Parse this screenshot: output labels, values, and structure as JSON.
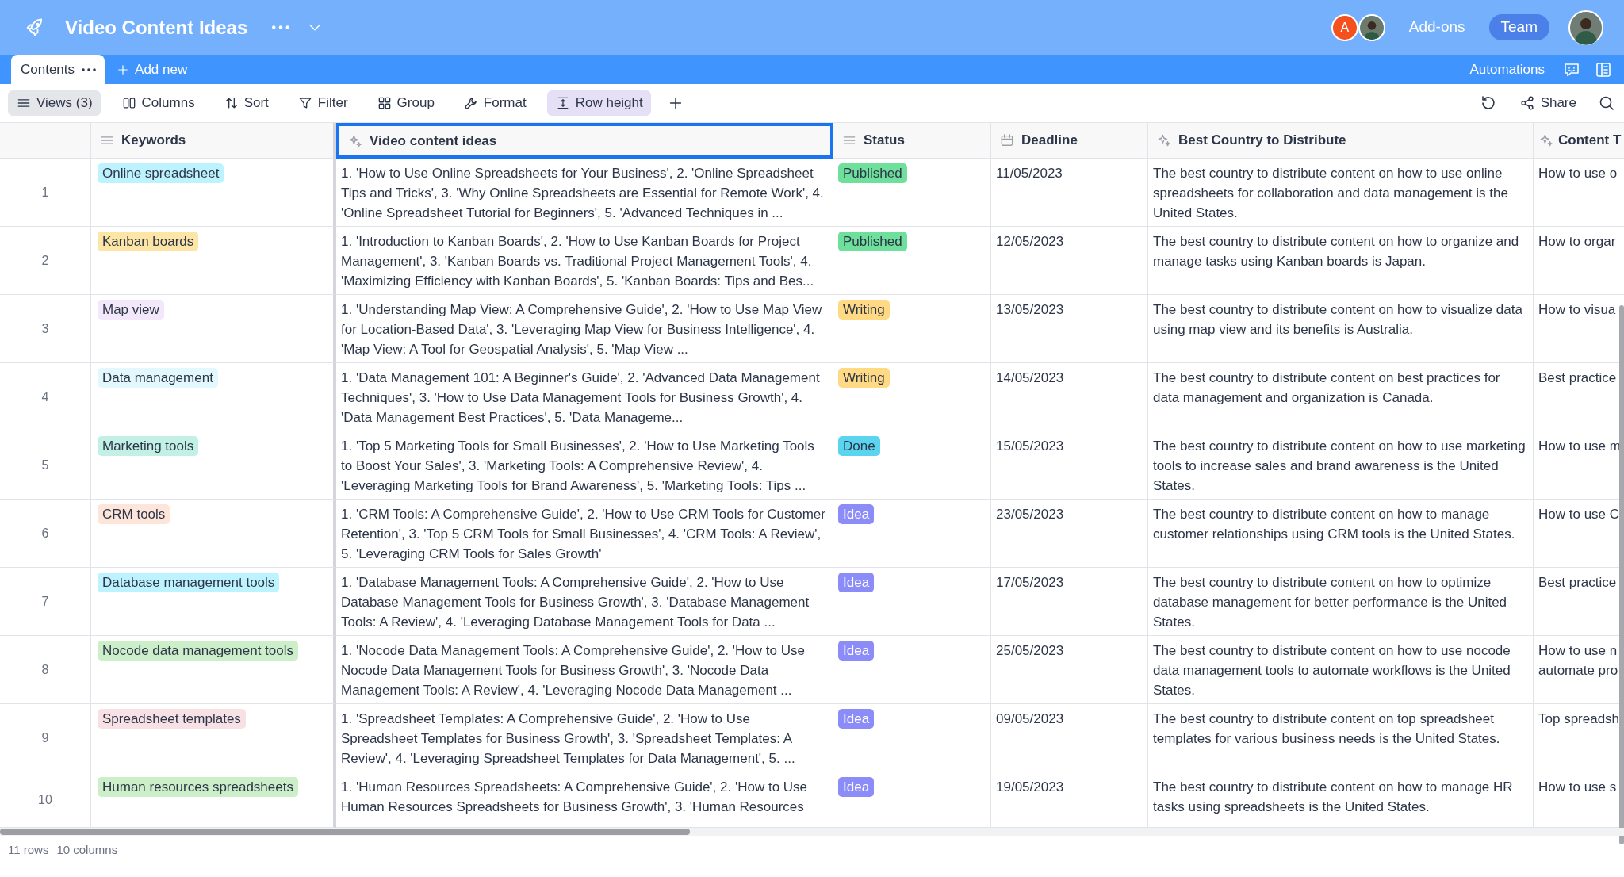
{
  "app": {
    "title": "Video Content Ideas",
    "avatars": [
      {
        "kind": "initial",
        "text": "A",
        "color": "#f4511e"
      },
      {
        "kind": "photo"
      }
    ],
    "addons": "Add-ons",
    "team": "Team"
  },
  "tabs": [
    {
      "label": "Contents",
      "selected": true
    }
  ],
  "add_new": "Add new",
  "automations": "Automations",
  "toolbar": [
    {
      "label": "Views (3)",
      "kind": "dropdown",
      "selected": false
    },
    {
      "label": "Columns",
      "kind": "tool",
      "selected": false
    },
    {
      "label": "Sort",
      "kind": "tool",
      "selected": false
    },
    {
      "label": "Filter",
      "kind": "tool",
      "selected": false
    },
    {
      "label": "Group",
      "kind": "tool",
      "selected": false
    },
    {
      "label": "Format",
      "kind": "tool",
      "selected": false
    },
    {
      "label": "Row height",
      "kind": "tool",
      "selected": true
    }
  ],
  "share": "Share",
  "columns": [
    {
      "label": "Keywords",
      "kind": "text",
      "selected": false
    },
    {
      "label": "Video content ideas",
      "kind": "ai",
      "selected": true
    },
    {
      "label": "Status",
      "kind": "text",
      "selected": false
    },
    {
      "label": "Deadline",
      "kind": "date",
      "selected": false
    },
    {
      "label": "Best Country to Distribute",
      "kind": "ai",
      "selected": false
    },
    {
      "label": "Content T",
      "kind": "ai",
      "selected": false
    }
  ],
  "rows": [
    {
      "number": "1",
      "keyword": {
        "text": "Online spreadsheet",
        "color": "#bdf3fe"
      },
      "ideas": "1. 'How to Use Online Spreadsheets for Your Business', 2. 'Online Spreadsheet Tips and Tricks', 3. 'Why Online Spreadsheets are Essential for Remote Work', 4. 'Online Spreadsheet Tutorial for Beginners', 5. 'Advanced Techniques in ...",
      "status": {
        "text": "Published",
        "color": "#6fe09b"
      },
      "deadline": "11/05/2023",
      "best_country": "The best country to distribute content on how to use online spreadsheets for collaboration and data management is the United States.",
      "content_to": "How to use o"
    },
    {
      "number": "2",
      "keyword": {
        "text": "Kanban boards",
        "color": "#fde5a6"
      },
      "ideas": "1. 'Introduction to Kanban Boards', 2. 'How to Use Kanban Boards for Project Management', 3. 'Kanban Boards vs. Traditional Project Management Tools', 4. 'Maximizing Efficiency with Kanban Boards', 5. 'Kanban Boards: Tips and Bes...",
      "status": {
        "text": "Published",
        "color": "#6fe09b"
      },
      "deadline": "12/05/2023",
      "best_country": "The best country to distribute content on how to organize and manage tasks using Kanban boards is Japan.",
      "content_to": "How to orgar"
    },
    {
      "number": "3",
      "keyword": {
        "text": "Map view",
        "color": "#f2e7fb"
      },
      "ideas": "1. 'Understanding Map View: A Comprehensive Guide', 2. 'How to Use Map View for Location-Based Data', 3. 'Leveraging Map View for Business Intelligence', 4. 'Map View: A Tool for Geospatial Analysis', 5. 'Map View ...",
      "status": {
        "text": "Writing",
        "color": "#ffd983"
      },
      "deadline": "13/05/2023",
      "best_country": "The best country to distribute content on how to visualize data using map view and its benefits is Australia.",
      "content_to": "How to visua"
    },
    {
      "number": "4",
      "keyword": {
        "text": "Data management",
        "color": "#e3f8fd"
      },
      "ideas": "1. 'Data Management 101: A Beginner's Guide', 2. 'Advanced Data Management Techniques', 3. 'How to Use Data Management Tools for Business Growth', 4. 'Data Management Best Practices', 5. 'Data Manageme...",
      "status": {
        "text": "Writing",
        "color": "#ffd983"
      },
      "deadline": "14/05/2023",
      "best_country": "The best country to distribute content on best practices for data management and organization is Canada.",
      "content_to": "Best practice"
    },
    {
      "number": "5",
      "keyword": {
        "text": "Marketing tools",
        "color": "#c3f0e4"
      },
      "ideas": "1. 'Top 5 Marketing Tools for Small Businesses', 2. 'How to Use Marketing Tools to Boost Your Sales', 3. 'Marketing Tools: A Comprehensive Review', 4. 'Leveraging Marketing Tools for Brand Awareness', 5. 'Marketing Tools: Tips ...",
      "status": {
        "text": "Done",
        "color": "#5bd4ef"
      },
      "deadline": "15/05/2023",
      "best_country": "The best country to distribute content on how to use marketing tools to increase sales and brand awareness is the United States.",
      "content_to": "How to use m"
    },
    {
      "number": "6",
      "keyword": {
        "text": "CRM tools",
        "color": "#fde5da"
      },
      "ideas": "1. 'CRM Tools: A Comprehensive Guide', 2. 'How to Use CRM Tools for Customer Retention', 3. 'Top 5 CRM Tools for Small Businesses', 4. 'CRM Tools: A Review', 5. 'Leveraging CRM Tools for Sales Growth'",
      "status": {
        "text": "Idea",
        "color": "#8c8cf8"
      },
      "deadline": "23/05/2023",
      "best_country": "The best country to distribute content on how to manage customer relationships using CRM tools is the United States.",
      "content_to": "How to use C"
    },
    {
      "number": "7",
      "keyword": {
        "text": "Database management tools",
        "color": "#bdf3fe"
      },
      "ideas": "1. 'Database Management Tools: A Comprehensive Guide', 2. 'How to Use Database Management Tools for Business Growth', 3. 'Database Management Tools: A Review', 4. 'Leveraging Database Management Tools for Data ...",
      "status": {
        "text": "Idea",
        "color": "#8c8cf8"
      },
      "deadline": "17/05/2023",
      "best_country": "The best country to distribute content on how to optimize database management for better performance is the United States.",
      "content_to": "Best practice"
    },
    {
      "number": "8",
      "keyword": {
        "text": "Nocode data management tools",
        "color": "#ccefc9"
      },
      "ideas": "1. 'Nocode Data Management Tools: A Comprehensive Guide', 2. 'How to Use Nocode Data Management Tools for Business Growth', 3. 'Nocode Data Management Tools: A Review', 4. 'Leveraging Nocode Data Management ...",
      "status": {
        "text": "Idea",
        "color": "#8c8cf8"
      },
      "deadline": "25/05/2023",
      "best_country": "The best country to distribute content on how to use nocode data management tools to automate workflows is the United States.",
      "content_to": "How to use n automate pro"
    },
    {
      "number": "9",
      "keyword": {
        "text": "Spreadsheet templates",
        "color": "#f8e1e5"
      },
      "ideas": "1. 'Spreadsheet Templates: A Comprehensive Guide', 2. 'How to Use Spreadsheet Templates for Business Growth', 3. 'Spreadsheet Templates: A Review', 4. 'Leveraging Spreadsheet Templates for Data Management', 5. ...",
      "status": {
        "text": "Idea",
        "color": "#8c8cf8"
      },
      "deadline": "09/05/2023",
      "best_country": "The best country to distribute content on top spreadsheet templates for various business needs is the United States.",
      "content_to": "Top spreadsh"
    },
    {
      "number": "10",
      "keyword": {
        "text": "Human resources spreadsheets",
        "color": "#ccefc9"
      },
      "ideas": "1. 'Human Resources Spreadsheets: A Comprehensive Guide', 2. 'How to Use Human Resources Spreadsheets for Business Growth', 3. 'Human Resources",
      "status": {
        "text": "Idea",
        "color": "#8c8cf8"
      },
      "deadline": "19/05/2023",
      "best_country": "The best country to distribute content on how to manage HR tasks using spreadsheets is the United States.",
      "content_to": "How to use s"
    }
  ],
  "footer": {
    "rows_count": "11 rows",
    "columns_count": "10 columns"
  }
}
